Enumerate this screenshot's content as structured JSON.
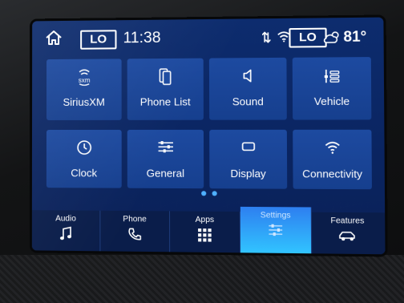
{
  "status_bar": {
    "left_temp_setting": "LO",
    "time": "11:38",
    "right_temp_setting": "LO",
    "outside_temp": "81°"
  },
  "tiles": [
    {
      "label": "SiriusXM",
      "icon": "siriusxm-icon"
    },
    {
      "label": "Phone List",
      "icon": "phone-list-icon"
    },
    {
      "label": "Sound",
      "icon": "speaker-icon"
    },
    {
      "label": "Vehicle",
      "icon": "vehicle-settings-icon"
    },
    {
      "label": "Clock",
      "icon": "clock-icon"
    },
    {
      "label": "General",
      "icon": "sliders-icon"
    },
    {
      "label": "Display",
      "icon": "display-icon"
    },
    {
      "label": "Connectivity",
      "icon": "wifi-icon"
    }
  ],
  "siriusxm_logo_text": "sxm",
  "page_indicator": {
    "pages": 2
  },
  "nav": [
    {
      "label": "Audio",
      "icon": "music-note-icon"
    },
    {
      "label": "Phone",
      "icon": "phone-icon"
    },
    {
      "label": "Apps",
      "icon": "apps-grid-icon"
    },
    {
      "label": "Settings",
      "icon": "settings-sliders-icon",
      "active": true
    },
    {
      "label": "Features",
      "icon": "car-icon"
    }
  ],
  "colors": {
    "screen_bg": "#0d2c6e",
    "tile_bg": "#1d4aa0",
    "active_tab": "#31c4ff",
    "dot": "#4fb0ff"
  }
}
